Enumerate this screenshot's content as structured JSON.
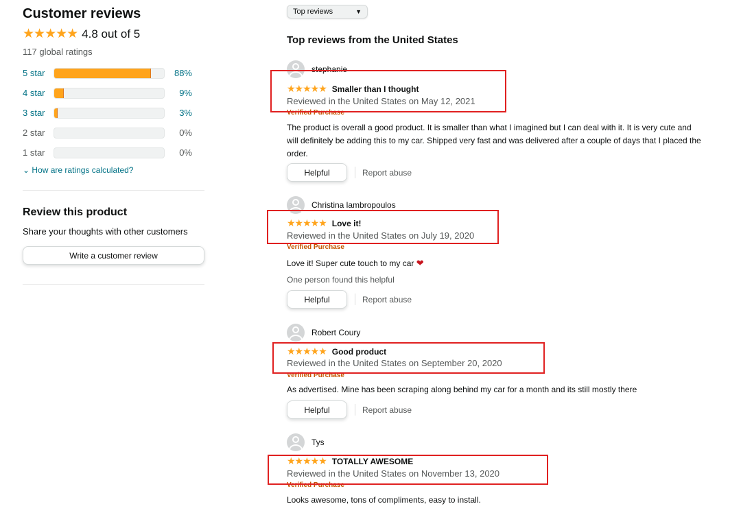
{
  "summary": {
    "title": "Customer reviews",
    "stars_icon": "★★★★★",
    "average_text": "4.8 out of 5",
    "global_ratings": "117 global ratings",
    "histogram": [
      {
        "label": "5 star",
        "percent_text": "88%",
        "percent": 88
      },
      {
        "label": "4 star",
        "percent_text": "9%",
        "percent": 9
      },
      {
        "label": "3 star",
        "percent_text": "3%",
        "percent": 3
      },
      {
        "label": "2 star",
        "percent_text": "0%",
        "percent": 0
      },
      {
        "label": "1 star",
        "percent_text": "0%",
        "percent": 0
      }
    ],
    "how_calculated": "How are ratings calculated?"
  },
  "write_review": {
    "title": "Review this product",
    "subtitle": "Share your thoughts with other customers",
    "button_label": "Write a customer review"
  },
  "sort": {
    "selected": "Top reviews"
  },
  "reviews_title": "Top reviews from the United States",
  "reviews": [
    {
      "author": "stephanie",
      "stars": "★★★★★",
      "headline": "Smaller than I thought",
      "date": "Reviewed in the United States on May 12, 2021",
      "verified": "Verified Purchase",
      "body": "The product is overall a good product. It is smaller than what I imagined but I can deal with it. It is very cute and will definitely be adding this to my car. Shipped very fast and was delivered after a couple of days that I placed the order.",
      "helpful_count": "",
      "helpful_label": "Helpful",
      "report_label": "Report abuse"
    },
    {
      "author": "Christina lambropoulos",
      "stars": "★★★★★",
      "headline": "Love it!",
      "date": "Reviewed in the United States on July 19, 2020",
      "verified": "Verified Purchase",
      "body": "Love it! Super cute touch to my car",
      "helpful_count": "One person found this helpful",
      "helpful_label": "Helpful",
      "report_label": "Report abuse"
    },
    {
      "author": "Robert Coury",
      "stars": "★★★★★",
      "headline": "Good product",
      "date": "Reviewed in the United States on September 20, 2020",
      "verified": "Verified Purchase",
      "body": "As advertised. Mine has been scraping along behind my car for a month and its still mostly there",
      "helpful_count": "",
      "helpful_label": "Helpful",
      "report_label": "Report abuse"
    },
    {
      "author": "Tys",
      "stars": "★★★★★",
      "headline": "TOTALLY AWESOME",
      "date": "Reviewed in the United States on November 13, 2020",
      "verified": "Verified Purchase",
      "body": "Looks awesome, tons of compliments, easy to install.",
      "helpful_count": "",
      "helpful_label": "",
      "report_label": ""
    }
  ],
  "colors": {
    "star": "#ffa41c",
    "link": "#007185",
    "verified": "#c45500",
    "highlight_box": "#e02020"
  }
}
